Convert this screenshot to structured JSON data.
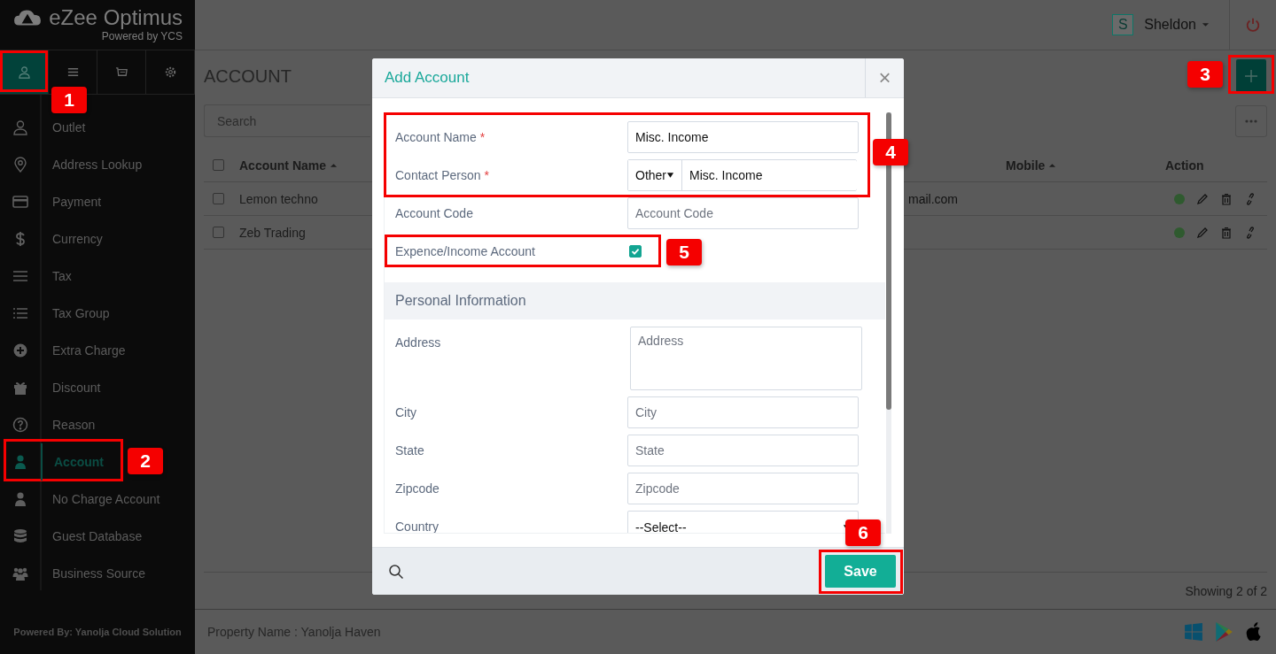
{
  "app": {
    "logo_title": "eZee Optimus",
    "logo_subtitle": "Powered by YCS"
  },
  "header": {
    "user_initial": "S",
    "user_name": "Sheldon"
  },
  "sidebar": {
    "tabs": [
      {
        "selected": true
      },
      {
        "selected": false
      },
      {
        "selected": false
      },
      {
        "selected": false
      }
    ],
    "items": [
      {
        "label": "Outlet",
        "selected": false
      },
      {
        "label": "Address Lookup",
        "selected": false
      },
      {
        "label": "Payment",
        "selected": false
      },
      {
        "label": "Currency",
        "selected": false
      },
      {
        "label": "Tax",
        "selected": false
      },
      {
        "label": "Tax Group",
        "selected": false
      },
      {
        "label": "Extra Charge",
        "selected": false
      },
      {
        "label": "Discount",
        "selected": false
      },
      {
        "label": "Reason",
        "selected": false
      },
      {
        "label": "Account",
        "selected": true
      },
      {
        "label": "No Charge Account",
        "selected": false
      },
      {
        "label": "Guest Database",
        "selected": false
      },
      {
        "label": "Business Source",
        "selected": false
      }
    ],
    "footer": "Powered By: Yanolja Cloud Solution"
  },
  "page": {
    "title": "ACCOUNT",
    "search": {
      "placeholder": "Search"
    },
    "select_all_checked": false,
    "columns": [
      {
        "label": "Account Name",
        "sorted": true
      },
      {
        "label": "Mobile",
        "sorted": true
      },
      {
        "label": "Action",
        "sorted": false
      }
    ],
    "rows": [
      {
        "account_name": "Lemon techno",
        "column_3": "mail.com",
        "checked": false,
        "active": true
      },
      {
        "account_name": "Zeb Trading",
        "checked": false,
        "active": true
      }
    ],
    "showing": "Showing 2 of 2"
  },
  "status_bar": {
    "property": "Property Name : Yanolja Haven"
  },
  "dialog": {
    "title": "Add Account",
    "close": "×",
    "fields": [
      {
        "kind": "text",
        "label": "Account Name",
        "required_mark": "*",
        "value": "Misc. Income"
      },
      {
        "kind": "select-text",
        "label": "Contact Person",
        "required_mark": "*",
        "option": "Other",
        "value": "Misc. Income"
      },
      {
        "kind": "text",
        "label": "Account Code",
        "placeholder": "Account Code"
      },
      {
        "kind": "checkbox",
        "label": "Expence/Income Account",
        "checked": true
      }
    ],
    "section_title": "Personal Information",
    "personal_fields": [
      {
        "kind": "textarea",
        "label": "Address",
        "placeholder": "Address"
      },
      {
        "kind": "text",
        "label": "City",
        "placeholder": "City"
      },
      {
        "kind": "text",
        "label": "State",
        "placeholder": "State"
      },
      {
        "kind": "text",
        "label": "Zipcode",
        "placeholder": "Zipcode"
      },
      {
        "kind": "select",
        "label": "Country",
        "value": "--Select--"
      }
    ],
    "save": "Save"
  },
  "callouts": [
    {
      "number": "1"
    },
    {
      "number": "2"
    },
    {
      "number": "3"
    },
    {
      "number": "4"
    },
    {
      "number": "5"
    },
    {
      "number": "6"
    }
  ]
}
